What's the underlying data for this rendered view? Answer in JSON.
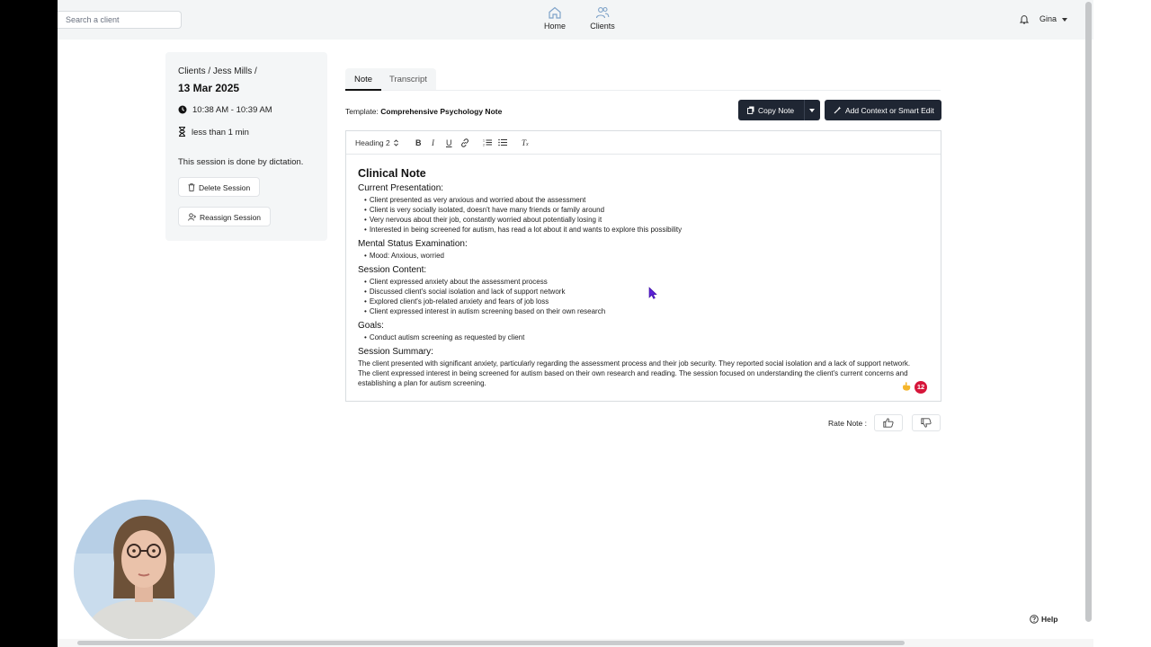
{
  "header": {
    "search_placeholder": "Search a client",
    "nav": [
      {
        "label": "Home",
        "icon": "home-icon"
      },
      {
        "label": "Clients",
        "icon": "users-icon"
      }
    ],
    "user_name": "Gina"
  },
  "session": {
    "breadcrumb": "Clients / Jess Mills /",
    "date": "13 Mar 2025",
    "time_range": "10:38 AM - 10:39 AM",
    "duration": "less than 1 min",
    "dictation_note": "This session is done by dictation.",
    "delete_label": "Delete Session",
    "reassign_label": "Reassign Session"
  },
  "tabs": [
    {
      "label": "Note",
      "active": true
    },
    {
      "label": "Transcript",
      "active": false
    }
  ],
  "template": {
    "prefix": "Template:",
    "name": "Comprehensive Psychology Note"
  },
  "actions": {
    "copy_label": "Copy Note",
    "context_label": "Add Context or Smart Edit"
  },
  "toolbar": {
    "heading_select": "Heading 2"
  },
  "note": {
    "title": "Clinical Note",
    "sections": [
      {
        "heading": "Current Presentation:",
        "items": [
          "Client presented as very anxious and worried about the assessment",
          "Client is very socially isolated, doesn't have many friends or family around",
          "Very nervous about their job, constantly worried about potentially losing it",
          "Interested in being screened for autism, has read a lot about it and wants to explore this possibility"
        ]
      },
      {
        "heading": "Mental Status Examination:",
        "items": [
          "Mood: Anxious, worried"
        ]
      },
      {
        "heading": "Session Content:",
        "items": [
          "Client expressed anxiety about the assessment process",
          "Discussed client's social isolation and lack of support network",
          "Explored client's job-related anxiety and fears of job loss",
          "Client expressed interest in autism screening based on their own research"
        ]
      },
      {
        "heading": "Goals:",
        "items": [
          "Conduct autism screening as requested by client"
        ]
      }
    ],
    "summary_heading": "Session Summary:",
    "summary_text": "The client presented with significant anxiety, particularly regarding the assessment process and their job security. They reported social isolation and a lack of support network. The client expressed interest in being screened for autism based on their own research and reading. The session focused on understanding the client's current concerns and establishing a plan for autism screening."
  },
  "grammar_badge": "12",
  "rating": {
    "label": "Rate Note :"
  },
  "help_label": "Help",
  "colors": {
    "primary_button": "#1f2633",
    "badge": "#d6163a",
    "panel": "#f4f6f7"
  }
}
